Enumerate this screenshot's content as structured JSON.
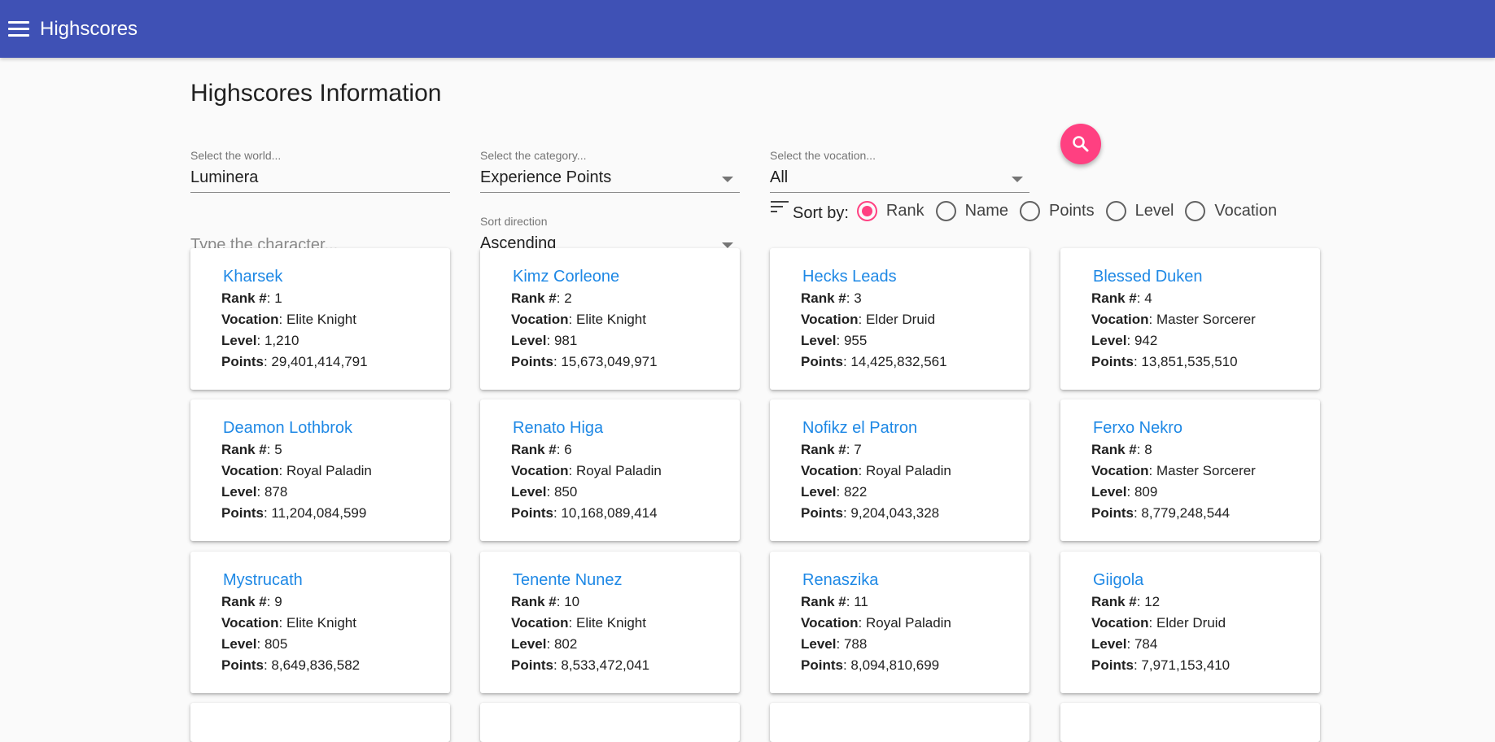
{
  "app": {
    "title": "Highscores"
  },
  "page": {
    "title": "Highscores Information"
  },
  "filters": {
    "world": {
      "label": "Select the world...",
      "value": "Luminera"
    },
    "category": {
      "label": "Select the category...",
      "value": "Experience Points"
    },
    "vocation": {
      "label": "Select the vocation...",
      "value": "All"
    },
    "character": {
      "placeholder": "Type the character..."
    },
    "sort_direction": {
      "label": "Sort direction",
      "value": "Ascending"
    }
  },
  "sort": {
    "label": "Sort by:",
    "options": [
      "Rank",
      "Name",
      "Points",
      "Level",
      "Vocation"
    ],
    "selected": "Rank"
  },
  "card_labels": {
    "rank": "Rank #",
    "vocation": "Vocation",
    "level": "Level",
    "points": "Points"
  },
  "players": [
    {
      "name": "Kharsek",
      "rank": "1",
      "vocation": "Elite Knight",
      "level": "1,210",
      "points": "29,401,414,791"
    },
    {
      "name": "Kimz Corleone",
      "rank": "2",
      "vocation": "Elite Knight",
      "level": "981",
      "points": "15,673,049,971"
    },
    {
      "name": "Hecks Leads",
      "rank": "3",
      "vocation": "Elder Druid",
      "level": "955",
      "points": "14,425,832,561"
    },
    {
      "name": "Blessed Duken",
      "rank": "4",
      "vocation": "Master Sorcerer",
      "level": "942",
      "points": "13,851,535,510"
    },
    {
      "name": "Deamon Lothbrok",
      "rank": "5",
      "vocation": "Royal Paladin",
      "level": "878",
      "points": "11,204,084,599"
    },
    {
      "name": "Renato Higa",
      "rank": "6",
      "vocation": "Royal Paladin",
      "level": "850",
      "points": "10,168,089,414"
    },
    {
      "name": "Nofikz el Patron",
      "rank": "7",
      "vocation": "Royal Paladin",
      "level": "822",
      "points": "9,204,043,328"
    },
    {
      "name": "Ferxo Nekro",
      "rank": "8",
      "vocation": "Master Sorcerer",
      "level": "809",
      "points": "8,779,248,544"
    },
    {
      "name": "Mystrucath",
      "rank": "9",
      "vocation": "Elite Knight",
      "level": "805",
      "points": "8,649,836,582"
    },
    {
      "name": "Tenente Nunez",
      "rank": "10",
      "vocation": "Elite Knight",
      "level": "802",
      "points": "8,533,472,041"
    },
    {
      "name": "Renaszika",
      "rank": "11",
      "vocation": "Royal Paladin",
      "level": "788",
      "points": "8,094,810,699"
    },
    {
      "name": "Giigola",
      "rank": "12",
      "vocation": "Elder Druid",
      "level": "784",
      "points": "7,971,153,410"
    }
  ]
}
